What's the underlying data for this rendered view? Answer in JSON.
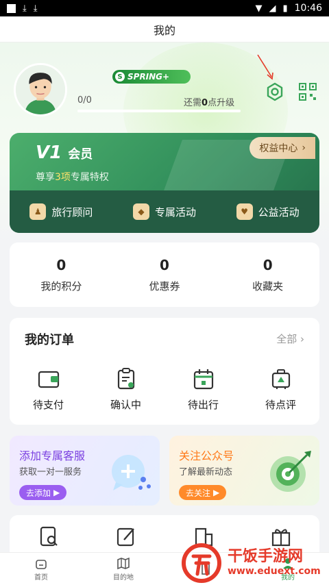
{
  "status_bar": {
    "time": "10:46"
  },
  "title": "我的",
  "profile": {
    "badge": "SPRING+",
    "badge_icon": "S",
    "progress_text": "0/0",
    "progress_fraction": 0,
    "upgrade_prefix": "还需",
    "upgrade_value": "0",
    "upgrade_suffix": "点升级"
  },
  "member": {
    "level": "V1",
    "level_name": "会员",
    "desc_prefix": "尊享",
    "desc_count": "3项",
    "desc_suffix": "专属特权",
    "rights_center": "权益中心",
    "perks": [
      {
        "label": "旅行顾问",
        "icon": "person-icon"
      },
      {
        "label": "专属活动",
        "icon": "diamond-icon"
      },
      {
        "label": "公益活动",
        "icon": "heart-icon"
      }
    ]
  },
  "stats": [
    {
      "value": "0",
      "label": "我的积分"
    },
    {
      "value": "0",
      "label": "优惠券"
    },
    {
      "value": "0",
      "label": "收藏夹"
    }
  ],
  "orders": {
    "title": "我的订单",
    "all": "全部",
    "items": [
      {
        "label": "待支付",
        "icon": "wallet-icon"
      },
      {
        "label": "确认中",
        "icon": "clipboard-icon"
      },
      {
        "label": "待出行",
        "icon": "calendar-icon"
      },
      {
        "label": "待点评",
        "icon": "suitcase-icon"
      }
    ]
  },
  "promos": [
    {
      "title": "添加专属客服",
      "subtitle": "获取一对一服务",
      "button": "去添加"
    },
    {
      "title": "关注公众号",
      "subtitle": "了解最新动态",
      "button": "去关注"
    }
  ],
  "bottom_nav": [
    {
      "label": "首页",
      "icon": "home-icon"
    },
    {
      "label": "目的地",
      "icon": "map-icon"
    },
    {
      "label": "",
      "icon": "building-icon"
    },
    {
      "label": "我的",
      "icon": "user-icon"
    }
  ],
  "watermark": {
    "name": "干饭手游网",
    "url": "www.eduext.com"
  },
  "colors": {
    "brand_green": "#2f9a4f",
    "member_green": "#2f8c5a",
    "gold": "#e7c89c",
    "purple": "#9a5ef0",
    "orange": "#ff8a2a"
  }
}
